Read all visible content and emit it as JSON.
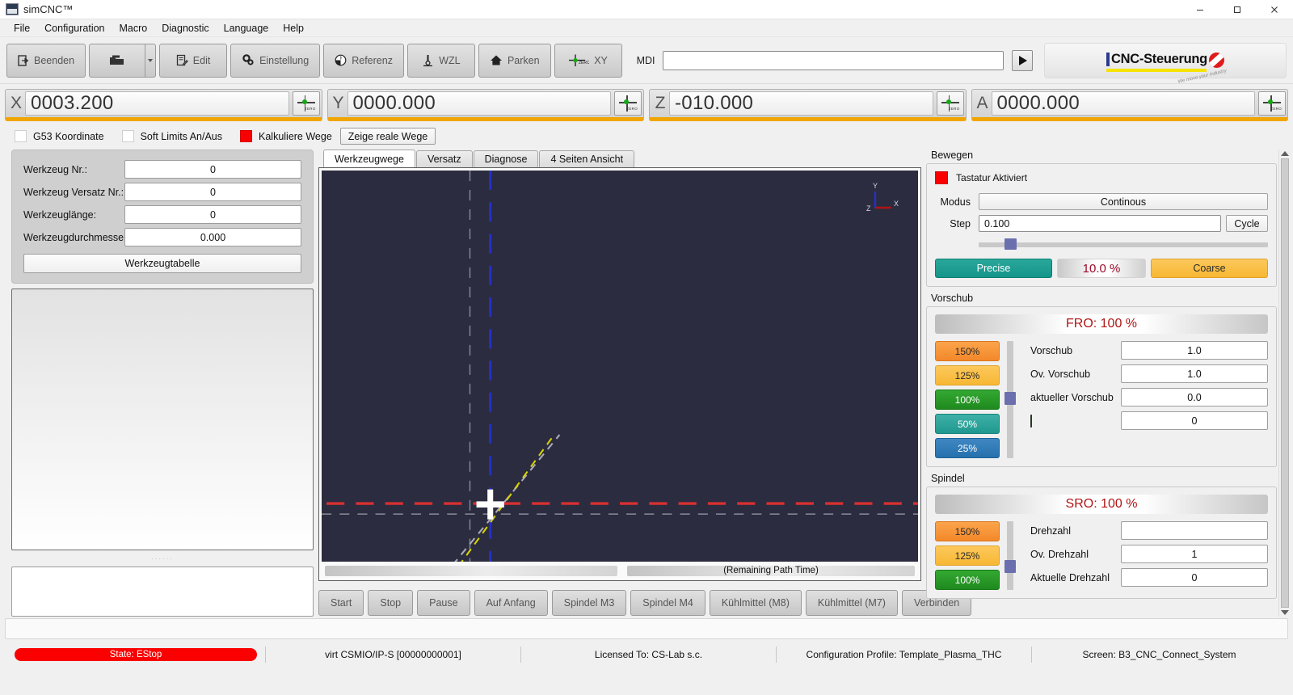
{
  "window": {
    "title": "simCNC™",
    "minimize": "minimize-icon",
    "maximize": "maximize-icon",
    "close": "close-icon"
  },
  "menu": [
    "File",
    "Configuration",
    "Macro",
    "Diagnostic",
    "Language",
    "Help"
  ],
  "toolbar": {
    "buttons": [
      {
        "label": "Beenden",
        "icon": "exit-icon"
      },
      {
        "label": "",
        "icon": "open-file-icon"
      },
      {
        "label": "Edit",
        "icon": "edit-icon"
      },
      {
        "label": "Einstellung",
        "icon": "gear-icon"
      },
      {
        "label": "Referenz",
        "icon": "reference-icon"
      },
      {
        "label": "WZL",
        "icon": "tool-length-icon"
      },
      {
        "label": "Parken",
        "icon": "home-icon"
      },
      {
        "label": "XY",
        "icon": "zero-xy-icon"
      }
    ],
    "mdi_label": "MDI",
    "mdi_value": "",
    "mdi_placeholder": "",
    "run_icon": "play-icon",
    "logo_text": "CNC-Steuerung",
    "logo_slogan": "We move your Industry"
  },
  "dro": {
    "axes": [
      {
        "name": "X",
        "value": "0003.200"
      },
      {
        "name": "Y",
        "value": "0000.000"
      },
      {
        "name": "Z",
        "value": "-010.000"
      },
      {
        "name": "A",
        "value": "0000.000"
      }
    ],
    "zero_button_label": "ZERO",
    "underline_color": "#f0a500"
  },
  "options_row": {
    "g53": {
      "label": "G53 Koordinate",
      "checked": false
    },
    "soft_limits": {
      "label": "Soft Limits An/Aus",
      "checked": false
    },
    "calc_paths": {
      "label": "Kalkuliere Wege",
      "checked": true
    },
    "real_paths_button": "Zeige reale Wege"
  },
  "tool_panel": {
    "fields": [
      {
        "label": "Werkzeug Nr.:",
        "value": "0"
      },
      {
        "label": "Werkzeug Versatz Nr.:",
        "value": "0"
      },
      {
        "label": "Werkzeuglänge:",
        "value": "0"
      },
      {
        "label": "Werkzeugdurchmesser:",
        "value": "0.000"
      }
    ],
    "table_button": "Werkzeugtabelle"
  },
  "viewer": {
    "tabs": [
      {
        "label": "Werkzeugwege",
        "active": true
      },
      {
        "label": "Versatz",
        "active": false
      },
      {
        "label": "Diagnose",
        "active": false
      },
      {
        "label": "4 Seiten Ansicht",
        "active": false
      }
    ],
    "axis_gizmo": {
      "x": "X",
      "y": "Y",
      "z": "Z"
    },
    "remaining_label": "(Remaining Path Time)",
    "background_color": "#2c2c40",
    "x_axis_color": "#d83030",
    "y_axis_color": "#2430c8",
    "path_color": "#d7d400"
  },
  "controls": [
    "Start",
    "Stop",
    "Pause",
    "Auf Anfang",
    "Spindel M3",
    "Spindel M4",
    "Kühlmittel (M8)",
    "Kühlmittel (M7)",
    "Verbinden"
  ],
  "jog": {
    "group_title": "Bewegen",
    "keyboard_label": "Tastatur Aktiviert",
    "keyboard_on": true,
    "mode_label": "Modus",
    "mode_value": "Continous",
    "step_label": "Step",
    "step_value": "0.100",
    "cycle_button": "Cycle",
    "precise_button": "Precise",
    "coarse_button": "Coarse",
    "rate_value": "10.0 %"
  },
  "feed": {
    "group_title": "Vorschub",
    "header": "FRO: 100 %",
    "override_buttons": [
      "150%",
      "125%",
      "100%",
      "50%",
      "25%"
    ],
    "fields": [
      {
        "label": "Vorschub",
        "value": "1.0"
      },
      {
        "label": "Ov. Vorschub",
        "value": "1.0"
      },
      {
        "label": "aktueller Vorschub",
        "value": "0.0"
      },
      {
        "label": "",
        "value": "0"
      }
    ]
  },
  "spindle": {
    "group_title": "Spindel",
    "header": "SRO: 100 %",
    "override_buttons": [
      "150%",
      "125%",
      "100%"
    ],
    "fields": [
      {
        "label": "Drehzahl",
        "value": ""
      },
      {
        "label": "Ov. Drehzahl",
        "value": "1"
      },
      {
        "label": "Aktuelle Drehzahl",
        "value": "0"
      }
    ]
  },
  "statusbar": {
    "state": "State: EStop",
    "device": "virt CSMIO/IP-S [00000000001]",
    "license": "Licensed To: CS-Lab s.c.",
    "profile": "Configuration Profile: Template_Plasma_THC",
    "screen": "Screen: B3_CNC_Connect_System"
  }
}
